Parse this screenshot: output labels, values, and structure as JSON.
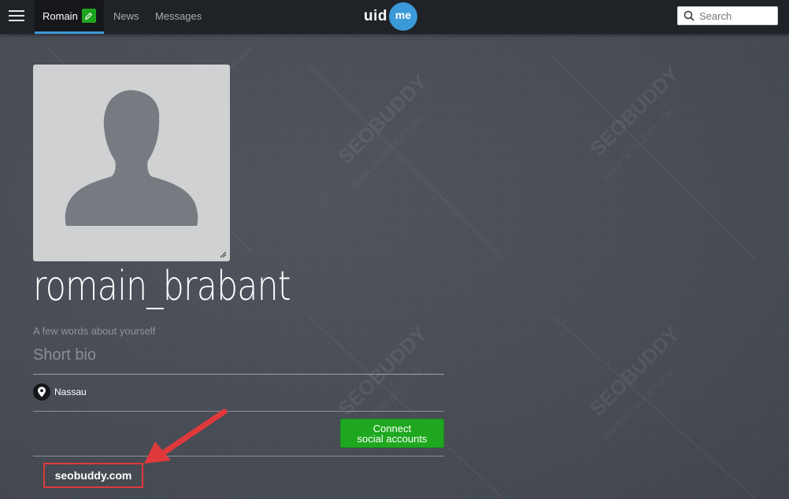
{
  "header": {
    "active_tab": "Romain",
    "nav_links": [
      "News",
      "Messages"
    ],
    "logo_left": "uid",
    "logo_right": "me",
    "search_placeholder": "Search"
  },
  "profile": {
    "username": "romain_brabant",
    "bio_hint": "A few words about yourself",
    "bio_placeholder": "Short bio",
    "location": "Nassau",
    "connect_button": [
      "Connect",
      "social accounts"
    ],
    "website": "seobuddy.com"
  },
  "watermark_text": [
    "SEOBUDDY",
    "WWW.SEOBUDDY.COM"
  ],
  "colors": {
    "accent_blue": "#3a9ad9",
    "green": "#1fa81f",
    "annotation_red": "#e0393c"
  },
  "icons": [
    "menu-icon",
    "pencil-icon",
    "search-icon",
    "resize-handle-icon",
    "location-pin-icon",
    "annotation-arrow"
  ]
}
